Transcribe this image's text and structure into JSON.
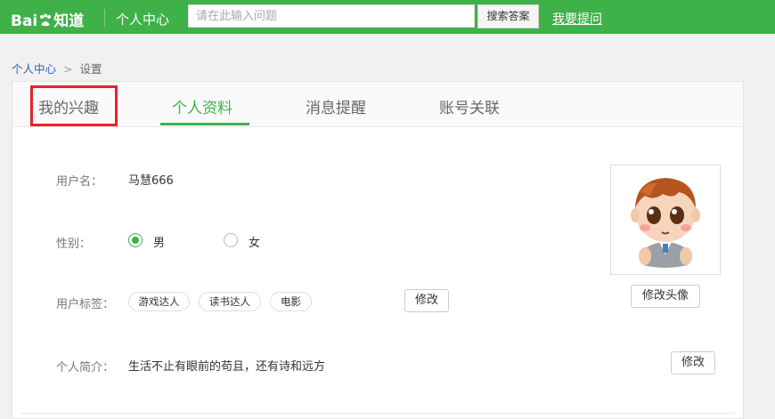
{
  "header": {
    "logo_text": "Bai",
    "logo_text_cn": "知道",
    "site_section": "个人中心",
    "search_placeholder": "请在此输入问题",
    "search_button": "搜索答案",
    "ask_link": "我要提问",
    "brand_color": "#3eb149"
  },
  "breadcrumb": {
    "home": "个人中心",
    "separator": ">",
    "current": "设置"
  },
  "tabs": [
    {
      "label": "我的兴趣",
      "active": false
    },
    {
      "label": "个人资料",
      "active": true
    },
    {
      "label": "消息提醒",
      "active": false
    },
    {
      "label": "账号关联",
      "active": false
    }
  ],
  "highlight_color": "#e8222a",
  "profile": {
    "username_label": "用户名：",
    "username": "马慧666",
    "gender_label": "性别：",
    "gender_options": [
      {
        "label": "男",
        "checked": true
      },
      {
        "label": "女",
        "checked": false
      }
    ],
    "tags_label": "用户标签：",
    "tags": [
      "游戏达人",
      "读书达人",
      "电影"
    ],
    "tags_edit": "修改",
    "bio_label": "个人简介：",
    "bio": "生活不止有眼前的苟且，还有诗和远方",
    "bio_edit": "修改",
    "avatar_edit": "修改头像"
  }
}
